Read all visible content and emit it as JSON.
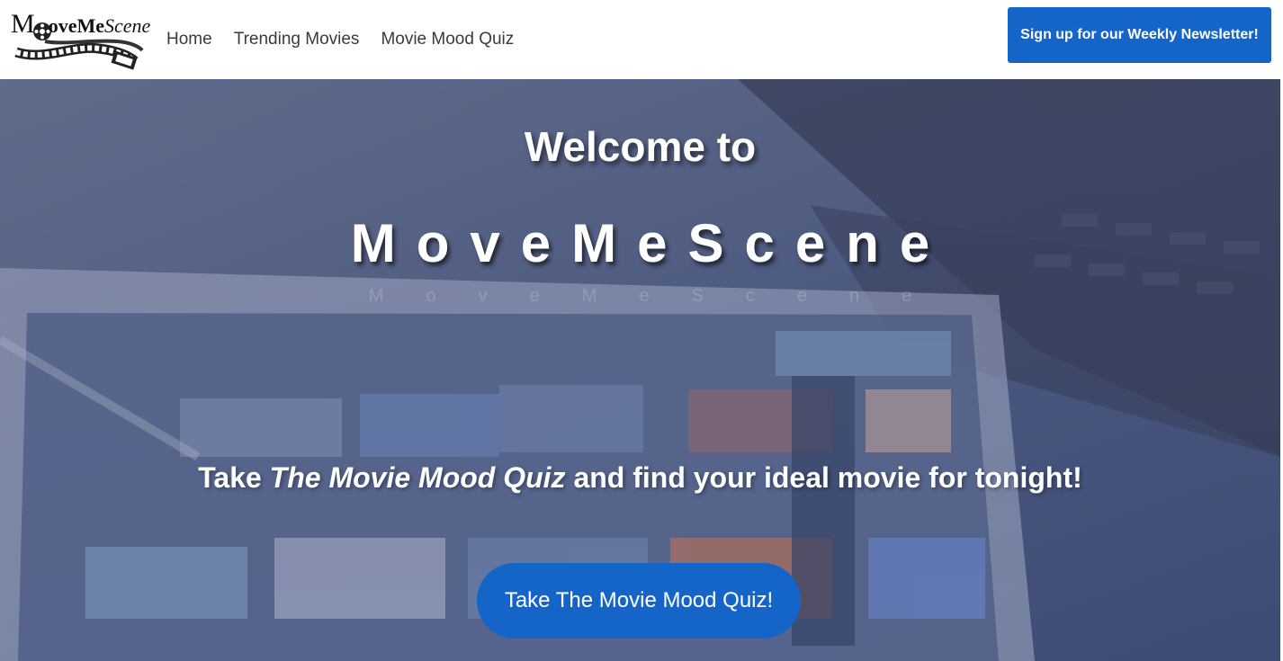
{
  "logo": {
    "first_letter": "M",
    "ove": "ove",
    "me": "Me",
    "scene": "Scene"
  },
  "nav": {
    "items": [
      {
        "label": "Home"
      },
      {
        "label": "Trending Movies"
      },
      {
        "label": "Movie Mood Quiz"
      }
    ],
    "newsletter_label": "Sign up for our Weekly Newsletter!"
  },
  "hero": {
    "welcome": "Welcome to",
    "brand": "MoveMeScene",
    "brand_reflection": "MoveMeScene",
    "tagline_start": "Take ",
    "tagline_em": "The Movie Mood Quiz",
    "tagline_end": " and find your ideal movie for tonight!",
    "cta_label": "Take The Movie Mood Quiz!"
  },
  "colors": {
    "accent": "#1565c9",
    "nav_text": "#3a3a3a",
    "hero_overlay": "#4b5a82"
  }
}
